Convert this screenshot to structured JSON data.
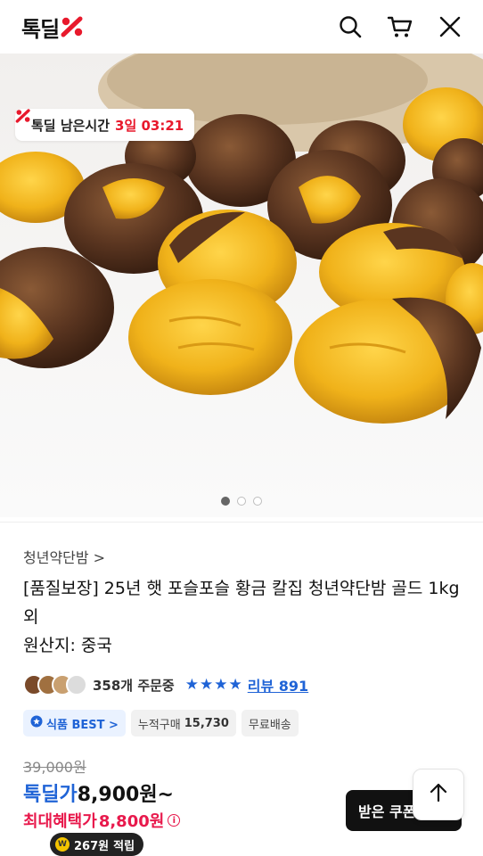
{
  "header": {
    "logo_text": "톡딜",
    "logo_mark": "%"
  },
  "timer": {
    "icon": "sale-percent-icon",
    "label": "톡딜 남은시간",
    "time": "3일 03:21"
  },
  "hero": {
    "image_alt": "roasted chestnuts",
    "dots": [
      true,
      false,
      false
    ]
  },
  "product": {
    "store": "청년약단밤 >",
    "title": "[품질보장] 25년 햇 포슬포슬 황금 칼집 청년약단밤 골드 1kg 외",
    "origin": "원산지: 중국"
  },
  "stats": {
    "orders": "358개 주문중",
    "rating": 4,
    "reviews": "리뷰 891"
  },
  "chips": {
    "best": "식품 BEST >",
    "cumulative_label": "누적구매",
    "cumulative_value": "15,730",
    "shipping": "무료배송"
  },
  "price": {
    "original": "39,000원",
    "deal_label": "톡딜가",
    "deal_value": "8,900원~",
    "max_label": "최대혜택가",
    "max_value": "8,800원"
  },
  "points": {
    "value": "267원",
    "suffix": "적립"
  },
  "buttons": {
    "coupon": "받은 쿠폰"
  },
  "colors": {
    "accent_red": "#e8192c",
    "accent_blue": "#1f63d6",
    "max_price_pink": "#e8194c"
  }
}
